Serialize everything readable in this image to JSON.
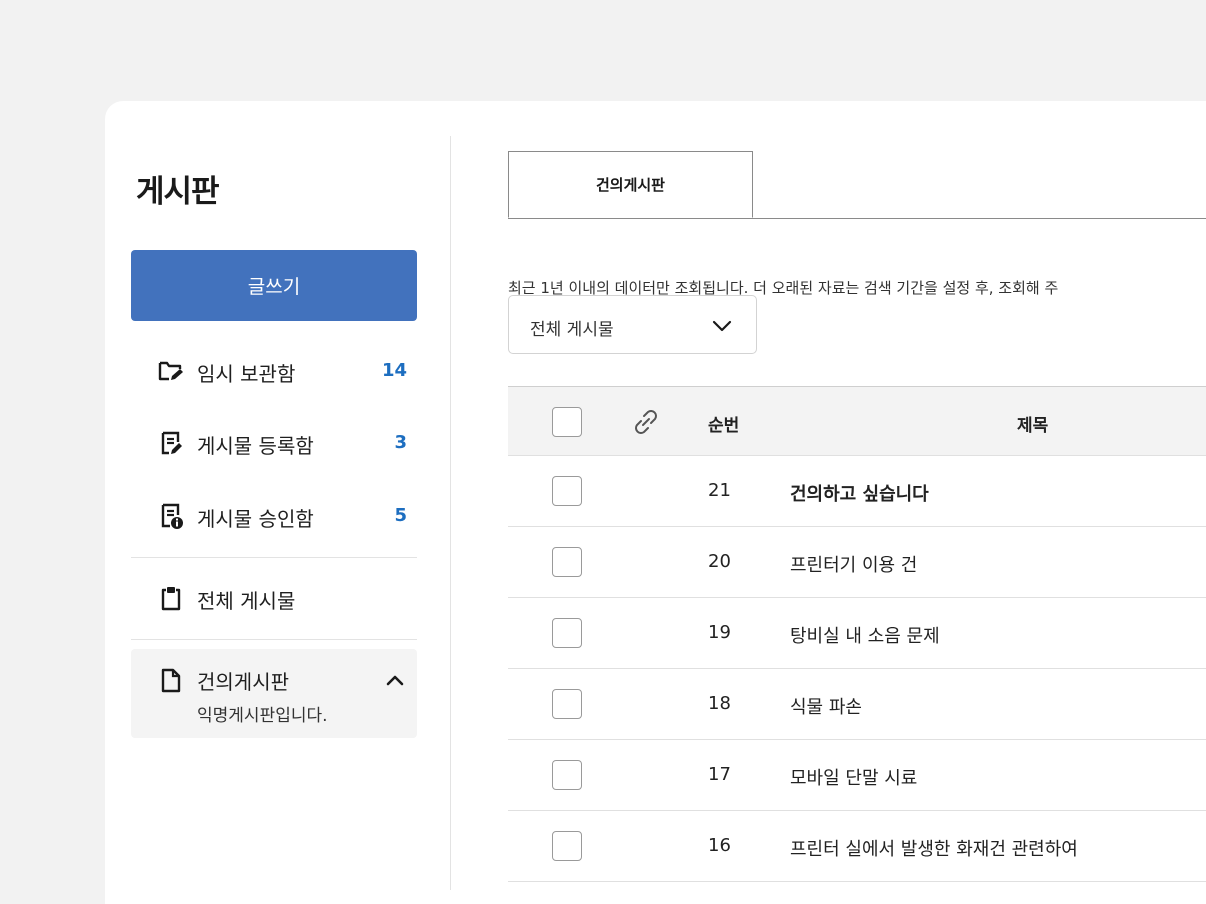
{
  "sidebar": {
    "title": "게시판",
    "write_button": "글쓰기",
    "items": [
      {
        "label": "임시 보관함",
        "count": "14"
      },
      {
        "label": "게시물 등록함",
        "count": "3"
      },
      {
        "label": "게시물 승인함",
        "count": "5"
      },
      {
        "label": "전체 게시물"
      }
    ],
    "board": {
      "label": "건의게시판",
      "description": "익명게시판입니다."
    }
  },
  "main": {
    "tab": "건의게시판",
    "notice": "최근 1년 이내의 데이터만 조회됩니다. 더 오래된 자료는 검색 기간을 설정 후, 조회해 주",
    "filter": {
      "selected": "전체 게시물"
    },
    "table": {
      "headers": {
        "number": "순번",
        "title": "제목"
      },
      "rows": [
        {
          "number": "21",
          "title": "건의하고 싶습니다"
        },
        {
          "number": "20",
          "title": "프린터기 이용 건"
        },
        {
          "number": "19",
          "title": "탕비실 내 소음 문제"
        },
        {
          "number": "18",
          "title": "식물 파손"
        },
        {
          "number": "17",
          "title": "모바일 단말 시료"
        },
        {
          "number": "16",
          "title": "프린터 실에서 발생한 화재건 관련하여"
        }
      ]
    }
  },
  "colors": {
    "accent": "#4272bd",
    "count": "#1d6ec0"
  },
  "icons": [
    "folder-edit-icon",
    "document-edit-icon",
    "document-info-icon",
    "clipboard-icon",
    "document-icon",
    "chevron-up-icon",
    "chevron-down-icon",
    "link-icon"
  ]
}
